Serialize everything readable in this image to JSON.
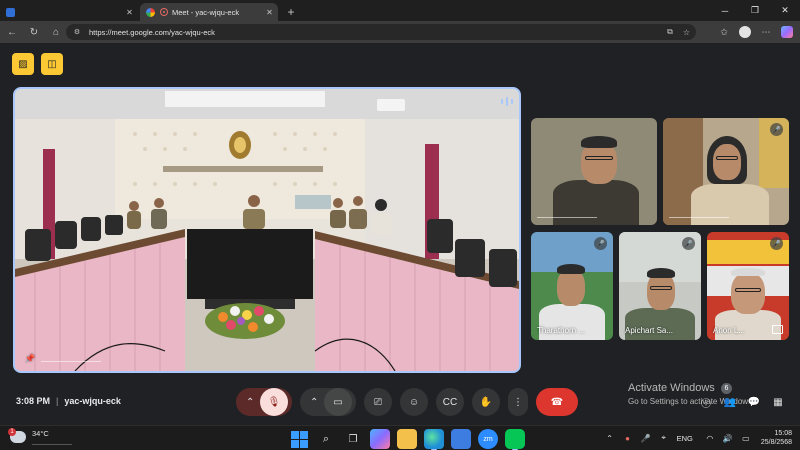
{
  "browser": {
    "tabs": [
      {
        "title": "",
        "icon_color": "#2f6fd6",
        "active": false
      },
      {
        "title": "Meet - yac-wjqu-eck",
        "icon_color": "#e46962",
        "active": true
      }
    ],
    "url": "https://meet.google.com/yac-wjqu-eck",
    "icons": {
      "back": "back-arrow-icon",
      "reload": "reload-icon",
      "home": "home-icon"
    }
  },
  "meet": {
    "main_tile": {
      "label": "",
      "border_color": "#a8c7fa"
    },
    "participants": [
      {
        "name": "",
        "muted": false
      },
      {
        "name": "",
        "muted": true
      },
      {
        "name": "Tharathorn ...",
        "muted": true
      },
      {
        "name": "Apichart Sa...",
        "muted": true
      },
      {
        "name": "Anon L...",
        "muted": true
      }
    ],
    "time": "3:08 PM",
    "meeting_code": "yac-wjqu-eck",
    "activate": {
      "line1": "Activate Windows",
      "line2": "Go to Settings to activate Windows.",
      "badge": "6"
    },
    "colors": {
      "end_call": "#dc362e",
      "muted_bg": "#f9dedc",
      "accent": "#fcc934"
    }
  },
  "taskbar": {
    "temp": "34°C",
    "weather_desc": "",
    "weather_badge": "1",
    "lang": "ENG",
    "time": "15:08",
    "date": "25/8/2568",
    "apps": [
      {
        "name": "Start",
        "color": "#1e88e5"
      },
      {
        "name": "Search",
        "color": "transparent"
      },
      {
        "name": "Task View",
        "color": "transparent"
      },
      {
        "name": "Copilot",
        "color": "#7b6cff"
      },
      {
        "name": "File Explorer",
        "color": "#f3c14b"
      },
      {
        "name": "Edge",
        "color": "#1f8fd6"
      },
      {
        "name": "Store",
        "color": "#3d7ce0"
      },
      {
        "name": "Zoom",
        "label": "zm",
        "color": "#2d8cff"
      },
      {
        "name": "LINE",
        "color": "#06c755"
      }
    ]
  }
}
